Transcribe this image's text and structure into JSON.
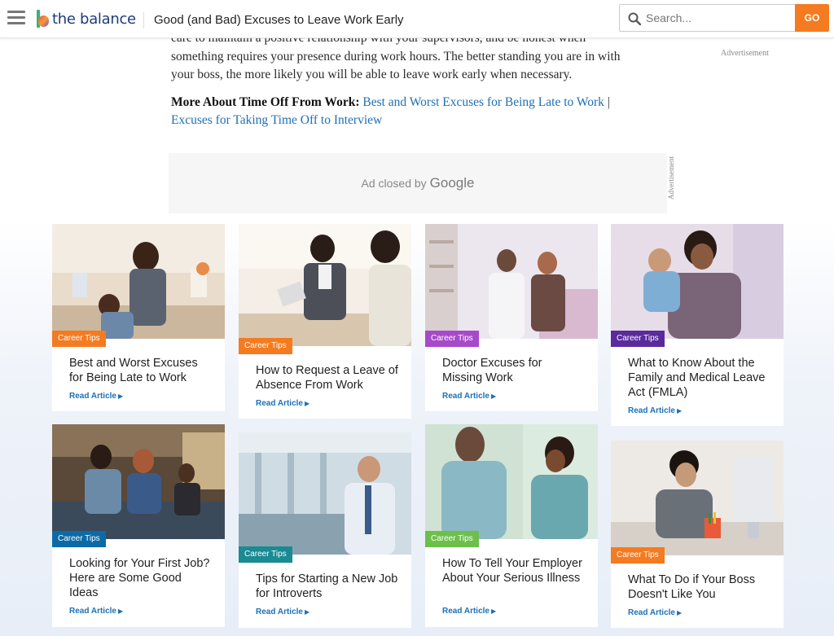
{
  "header": {
    "logo_text": "the balance",
    "title": "Good (and Bad) Excuses to Leave Work Early",
    "search_placeholder": "Search...",
    "go_label": "GO"
  },
  "article": {
    "para_fragment": "care to maintain a positive relationship with your supervisors, and be honest when something requires your presence during work hours. The better standing you are in with your boss, the more likely you will be able to leave work early when necessary.",
    "more_label": "More About Time Off From Work:",
    "link1": "Best and Worst Excuses for Being Late to Work",
    "separator": "|",
    "link2": "Excuses for Taking Time Off to Interview"
  },
  "ads": {
    "side_label": "Advertisement",
    "closed_text": "Ad closed by",
    "closed_brand": "Google",
    "vertical_label": "Advertisement"
  },
  "cards": [
    {
      "tag": "Career Tips",
      "title": "Best and Worst Excuses for Being Late to Work",
      "read": "Read Article",
      "tag_color": "#f47b20"
    },
    {
      "tag": "Career Tips",
      "title": "How to Request a Leave of Absence From Work",
      "read": "Read Article",
      "tag_color": "#f47b20"
    },
    {
      "tag": "Career Tips",
      "title": "Doctor Excuses for Missing Work",
      "read": "Read Article",
      "tag_color": "#a64ac9"
    },
    {
      "tag": "Career Tips",
      "title": "What to Know About the Family and Medical Leave Act (FMLA)",
      "read": "Read Article",
      "tag_color": "#5b2a9c"
    },
    {
      "tag": "Career Tips",
      "title": "Looking for Your First Job? Here are Some Good Ideas",
      "read": "Read Article",
      "tag_color": "#0c6aa6"
    },
    {
      "tag": "Career Tips",
      "title": "Tips for Starting a New Job for Introverts",
      "read": "Read Article",
      "tag_color": "#1a8a93"
    },
    {
      "tag": "Career Tips",
      "title": "How To Tell Your Employer About Your Serious Illness",
      "read": "Read Article",
      "tag_color": "#6cc04a"
    },
    {
      "tag": "Career Tips",
      "title": "What To Do if Your Boss Doesn't Like You",
      "read": "Read Article",
      "tag_color": "#f47b20"
    }
  ]
}
